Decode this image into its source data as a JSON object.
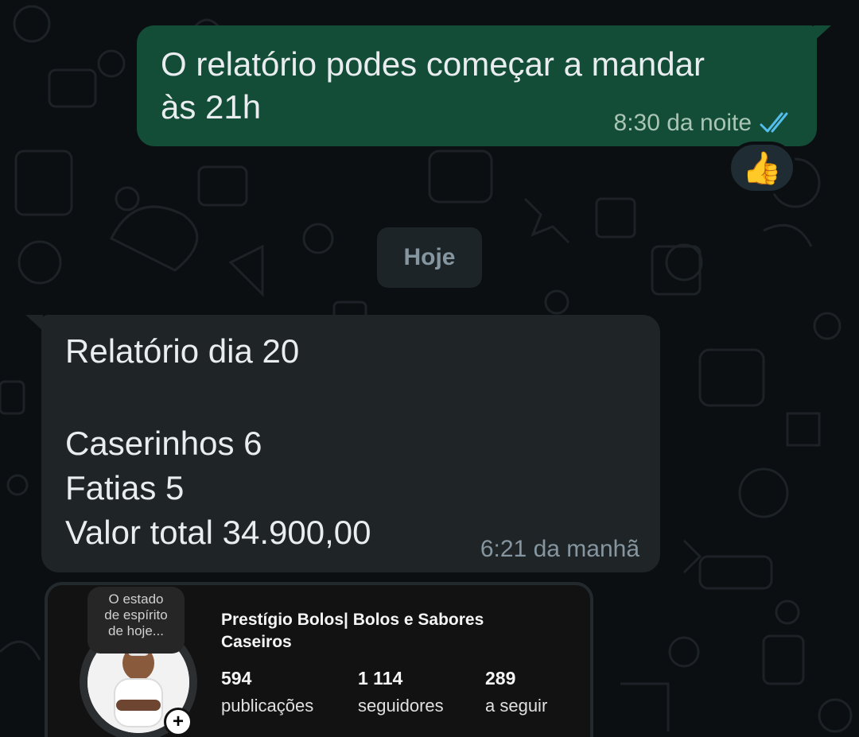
{
  "outgoing_message": {
    "text_line1": "O relatório podes começar a mandar",
    "text_line2": "às 21h",
    "time": "8:30 da noite",
    "status": "read",
    "status_color": "#53bdeb",
    "reaction": "👍"
  },
  "date_divider": {
    "label": "Hoje"
  },
  "incoming_message": {
    "lines": [
      "Relatório dia 20",
      "",
      "Caserinhos 6",
      "Fatias 5",
      "Valor total 34.900,00"
    ],
    "time": "6:21 da manhã"
  },
  "instagram_card": {
    "note": [
      "O estado",
      "de espírito",
      "de hoje..."
    ],
    "name_line1": "Prestígio Bolos| Bolos e Sabores",
    "name_line2": "Caseiros",
    "stats": [
      {
        "value": "594",
        "label": "publicações"
      },
      {
        "value": "1 114",
        "label": "seguidores"
      },
      {
        "value": "289",
        "label": "a seguir"
      }
    ],
    "add_badge": "+"
  },
  "colors": {
    "background": "#0b0f11",
    "outgoing_bubble": "#144d37",
    "incoming_bubble": "#1f2427"
  }
}
